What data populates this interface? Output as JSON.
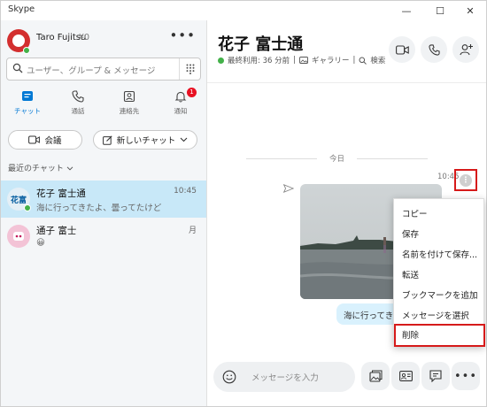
{
  "window": {
    "title": "Skype"
  },
  "profile": {
    "name": "Taro Fujitsu",
    "credit": "¥0"
  },
  "search": {
    "placeholder": "ユーザー、グループ & メッセージ"
  },
  "nav": [
    {
      "label": "チャット"
    },
    {
      "label": "通話"
    },
    {
      "label": "連絡先"
    },
    {
      "label": "通知",
      "badge": "1"
    }
  ],
  "actions": {
    "meeting": "会議",
    "new_chat": "新しいチャット"
  },
  "recent": {
    "label": "最近のチャット"
  },
  "chats": [
    {
      "avatar": "花富",
      "name": "花子 富士通",
      "preview": "海に行ってきたよ、曇ってたけど",
      "time": "10:45"
    },
    {
      "avatar": "",
      "name": "通子 富士",
      "preview": "😀",
      "time": "月"
    }
  ],
  "conversation": {
    "title": "花子 富士通",
    "last_seen": "最終利用: 36 分前",
    "gallery": "ギャラリー",
    "search": "検索",
    "date_divider": "今日",
    "message_time": "10:45",
    "message_text": "海に行ってきたよ、曇ってたけど"
  },
  "context_menu": [
    "コピー",
    "保存",
    "名前を付けて保存...",
    "転送",
    "ブックマークを追加",
    "メッセージを選択",
    "削除"
  ],
  "composer": {
    "placeholder": "メッセージを入力"
  },
  "colors": {
    "accent": "#0078d4",
    "highlight": "#d61a1a",
    "online": "#43b149",
    "selected_chat": "#c8e8f8",
    "bubble": "#d9f1fd"
  }
}
